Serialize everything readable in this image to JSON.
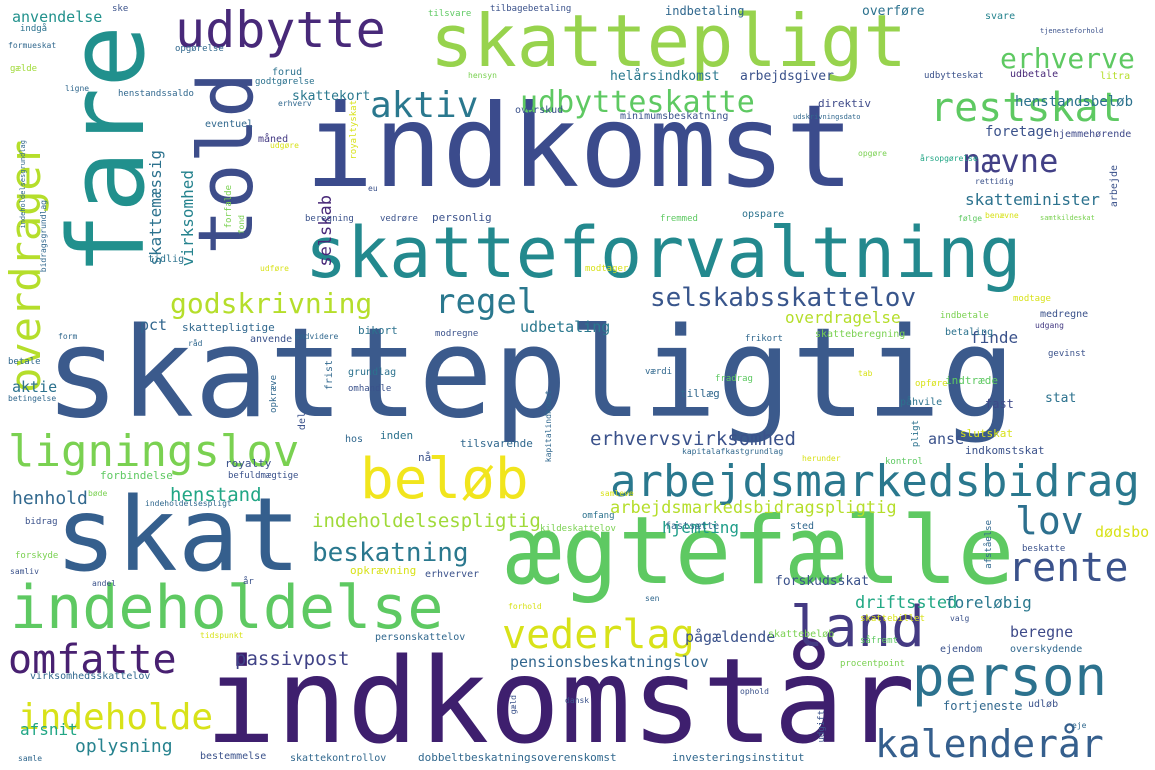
{
  "words": [
    {
      "text": "skattepligtig",
      "color": "#3b5a8c"
    },
    {
      "text": "indkomst",
      "color": "#3b4b8c"
    },
    {
      "text": "indkomstår",
      "color": "#3e1f6e"
    },
    {
      "text": "skattepligt",
      "color": "#97d34d"
    },
    {
      "text": "skatteforvaltning",
      "color": "#23898e"
    },
    {
      "text": "skat",
      "color": "#355f8d"
    },
    {
      "text": "ægtefælle",
      "color": "#5ec962"
    },
    {
      "text": "indeholdelse",
      "color": "#5ec962"
    },
    {
      "text": "fare",
      "color": "#21908d"
    },
    {
      "text": "told",
      "color": "#3d4d8a"
    },
    {
      "text": "udbytte",
      "color": "#482979"
    },
    {
      "text": "person",
      "color": "#2c728e"
    },
    {
      "text": "land",
      "color": "#443a83"
    },
    {
      "text": "arbejdsmarkedsbidrag",
      "color": "#2a788e"
    },
    {
      "text": "beløb",
      "color": "#f1e51d"
    },
    {
      "text": "ligningslov",
      "color": "#7ad151"
    },
    {
      "text": "omfatte",
      "color": "#482071"
    },
    {
      "text": "vederlag",
      "color": "#d8e219"
    },
    {
      "text": "kalenderår",
      "color": "#355f8d"
    },
    {
      "text": "rente",
      "color": "#3b528b"
    },
    {
      "text": "lov",
      "color": "#2d708e"
    },
    {
      "text": "restskat",
      "color": "#5ec962"
    },
    {
      "text": "aktiv",
      "color": "#2a788e"
    },
    {
      "text": "udbytteskatte",
      "color": "#5ec962"
    },
    {
      "text": "nævne",
      "color": "#424086"
    },
    {
      "text": "overdrager",
      "color": "#b5de2b"
    },
    {
      "text": "godskrivning",
      "color": "#b5de2b"
    },
    {
      "text": "regel",
      "color": "#2a788e"
    },
    {
      "text": "selskabsskattelov",
      "color": "#39568c"
    },
    {
      "text": "erhverve",
      "color": "#5ec962"
    },
    {
      "text": "indeholde",
      "color": "#d8e219"
    },
    {
      "text": "beskatning",
      "color": "#2a788e"
    },
    {
      "text": "henstand",
      "color": "#21a685"
    },
    {
      "text": "indeholdelsespligtig",
      "color": "#a0da39"
    },
    {
      "text": "erhvervsvirksomhed",
      "color": "#3b528b"
    },
    {
      "text": "arbejdsmarkedsbidragspligtig",
      "color": "#b5de2b"
    },
    {
      "text": "passivpost",
      "color": "#404387"
    },
    {
      "text": "pensionsbeskatningslov",
      "color": "#31668e"
    },
    {
      "text": "oplysning",
      "color": "#26828e"
    },
    {
      "text": "afsnit",
      "color": "#21a685"
    },
    {
      "text": "anvendelse",
      "color": "#21918c"
    },
    {
      "text": "henstandsbeløb",
      "color": "#2c728e"
    },
    {
      "text": "skatteminister",
      "color": "#2c728e"
    },
    {
      "text": "foretage",
      "color": "#3b528b"
    },
    {
      "text": "hjemmehørende",
      "color": "#3e4989"
    },
    {
      "text": "overdragelse",
      "color": "#b5de2b"
    },
    {
      "text": "udbetaling",
      "color": "#2a788e"
    },
    {
      "text": "finde",
      "color": "#3b528b"
    },
    {
      "text": "pct",
      "color": "#31668e"
    },
    {
      "text": "aktie",
      "color": "#2c728e"
    },
    {
      "text": "henhold",
      "color": "#31688e"
    },
    {
      "text": "hjemting",
      "color": "#1f9e89"
    },
    {
      "text": "dødsbo",
      "color": "#d8e219"
    },
    {
      "text": "driftssted",
      "color": "#22a884"
    },
    {
      "text": "pågældende",
      "color": "#3b528b"
    },
    {
      "text": "foreløbig",
      "color": "#2a788e"
    },
    {
      "text": "beregne",
      "color": "#3e4a89"
    },
    {
      "text": "forskudsskat",
      "color": "#3b528b"
    },
    {
      "text": "fortjeneste",
      "color": "#31688e"
    },
    {
      "text": "anse",
      "color": "#3b528b"
    },
    {
      "text": "fast",
      "color": "#3e4a89"
    },
    {
      "text": "stat",
      "color": "#2c728e"
    },
    {
      "text": "selskab",
      "color": "#482878"
    },
    {
      "text": "skattemæssig",
      "color": "#2c728e"
    },
    {
      "text": "virksomhed",
      "color": "#25838e"
    },
    {
      "text": "skattekort",
      "color": "#2a788e"
    },
    {
      "text": "helårsindkomst",
      "color": "#2a788e"
    },
    {
      "text": "arbejdsgiver",
      "color": "#3b528b"
    },
    {
      "text": "direktiv",
      "color": "#3e4a89"
    },
    {
      "text": "minimumsbeskatning",
      "color": "#3b528b"
    },
    {
      "text": "indbetaling",
      "color": "#31688e"
    },
    {
      "text": "overføre",
      "color": "#2c728e"
    },
    {
      "text": "svare",
      "color": "#25838e"
    },
    {
      "text": "tilsvare",
      "color": "#5ec962"
    },
    {
      "text": "tilbagebetaling",
      "color": "#3b528b"
    },
    {
      "text": "udbetale",
      "color": "#482878"
    },
    {
      "text": "udbytteskat",
      "color": "#3b528b"
    },
    {
      "text": "litra",
      "color": "#b5de2b"
    },
    {
      "text": "overskud",
      "color": "#3b528b"
    },
    {
      "text": "forud",
      "color": "#2c728e"
    },
    {
      "text": "godtgørelse",
      "color": "#2c728e"
    },
    {
      "text": "eventuel",
      "color": "#31688e"
    },
    {
      "text": "måned",
      "color": "#443a83"
    },
    {
      "text": "henstandssaldo",
      "color": "#31688e"
    },
    {
      "text": "ske",
      "color": "#3b528b"
    },
    {
      "text": "indgå",
      "color": "#2c728e"
    },
    {
      "text": "formueskat",
      "color": "#31688e"
    },
    {
      "text": "gælde",
      "color": "#a0da39"
    },
    {
      "text": "ligne",
      "color": "#31688e"
    },
    {
      "text": "opgørelse",
      "color": "#31688e"
    },
    {
      "text": "tidlig",
      "color": "#2c728e"
    },
    {
      "text": "beregning",
      "color": "#3b528b"
    },
    {
      "text": "vedrøre",
      "color": "#3b528b"
    },
    {
      "text": "personlig",
      "color": "#3b528b"
    },
    {
      "text": "fremmed",
      "color": "#5ec962"
    },
    {
      "text": "opspare",
      "color": "#2c728e"
    },
    {
      "text": "følge",
      "color": "#5ec962"
    },
    {
      "text": "benævne",
      "color": "#d8e219"
    },
    {
      "text": "samtkildeskat",
      "color": "#7ad151"
    },
    {
      "text": "rettidig",
      "color": "#3b528b"
    },
    {
      "text": "årsopgørelse",
      "color": "#21a685"
    },
    {
      "text": "opgøre",
      "color": "#7ad151"
    },
    {
      "text": "udskrivningsdato",
      "color": "#31688e"
    },
    {
      "text": "arbejde",
      "color": "#3b528b"
    },
    {
      "text": "modtage",
      "color": "#d8e219"
    },
    {
      "text": "medregne",
      "color": "#3b528b"
    },
    {
      "text": "udgang",
      "color": "#443a83"
    },
    {
      "text": "betaling",
      "color": "#2c728e"
    },
    {
      "text": "indbetale",
      "color": "#7ad151"
    },
    {
      "text": "skatteberegning",
      "color": "#7ad151"
    },
    {
      "text": "frikort",
      "color": "#31688e"
    },
    {
      "text": "gevinst",
      "color": "#3b528b"
    },
    {
      "text": "påhvile",
      "color": "#2c728e"
    },
    {
      "text": "indtræde",
      "color": "#5ec962"
    },
    {
      "text": "opføre",
      "color": "#d8e219"
    },
    {
      "text": "tillæg",
      "color": "#31688e"
    },
    {
      "text": "fradrag",
      "color": "#5ec962"
    },
    {
      "text": "værdi",
      "color": "#31688e"
    },
    {
      "text": "tab",
      "color": "#d8e219"
    },
    {
      "text": "modregne",
      "color": "#3b528b"
    },
    {
      "text": "bikort",
      "color": "#2c728e"
    },
    {
      "text": "skattepligtige",
      "color": "#31688e"
    },
    {
      "text": "anvende",
      "color": "#3b528b"
    },
    {
      "text": "endvidere",
      "color": "#31688e"
    },
    {
      "text": "form",
      "color": "#31688e"
    },
    {
      "text": "råd",
      "color": "#31688e"
    },
    {
      "text": "betale",
      "color": "#31688e"
    },
    {
      "text": "betingelse",
      "color": "#31688e"
    },
    {
      "text": "grundlag",
      "color": "#2c728e"
    },
    {
      "text": "omhandle",
      "color": "#3b528b"
    },
    {
      "text": "frist",
      "color": "#31688e"
    },
    {
      "text": "opkræve",
      "color": "#31688e"
    },
    {
      "text": "del",
      "color": "#3b528b"
    },
    {
      "text": "hos",
      "color": "#31688e"
    },
    {
      "text": "inden",
      "color": "#2c728e"
    },
    {
      "text": "nå",
      "color": "#3b528b"
    },
    {
      "text": "tilsvarende",
      "color": "#31688e"
    },
    {
      "text": "kapitalafkastgrundlag",
      "color": "#31688e"
    },
    {
      "text": "kapitalindkomst",
      "color": "#31688e"
    },
    {
      "text": "herunder",
      "color": "#d8e219"
    },
    {
      "text": "kontrol",
      "color": "#5ec962"
    },
    {
      "text": "slutskat",
      "color": "#d8e219"
    },
    {
      "text": "indkomstskat",
      "color": "#3b528b"
    },
    {
      "text": "pligt",
      "color": "#2c728e"
    },
    {
      "text": "forbindelse",
      "color": "#5ec962"
    },
    {
      "text": "royalty",
      "color": "#3b528b"
    },
    {
      "text": "befuldmægtige",
      "color": "#3b528b"
    },
    {
      "text": "bøde",
      "color": "#7ad151"
    },
    {
      "text": "bidrag",
      "color": "#3b528b"
    },
    {
      "text": "indeholdelsespligt",
      "color": "#31688e"
    },
    {
      "text": "samleve",
      "color": "#d8e219"
    },
    {
      "text": "omfang",
      "color": "#2c728e"
    },
    {
      "text": "kildeskattelov",
      "color": "#7ad151"
    },
    {
      "text": "fastsætte",
      "color": "#31688e"
    },
    {
      "text": "sted",
      "color": "#31688e"
    },
    {
      "text": "forskyde",
      "color": "#7ad151"
    },
    {
      "text": "samliv",
      "color": "#3b528b"
    },
    {
      "text": "andel",
      "color": "#3b528b"
    },
    {
      "text": "år",
      "color": "#3b528b"
    },
    {
      "text": "opkrævning",
      "color": "#d8e219"
    },
    {
      "text": "erhverver",
      "color": "#3b528b"
    },
    {
      "text": "afståelse",
      "color": "#31688e"
    },
    {
      "text": "beskatte",
      "color": "#3b528b"
    },
    {
      "text": "forhold",
      "color": "#d8e219"
    },
    {
      "text": "sen",
      "color": "#31688e"
    },
    {
      "text": "skattebillet",
      "color": "#d8e219"
    },
    {
      "text": "valg",
      "color": "#3b528b"
    },
    {
      "text": "skattebeløb",
      "color": "#7ad151"
    },
    {
      "text": "såfremt",
      "color": "#5ec962"
    },
    {
      "text": "ejendom",
      "color": "#3b528b"
    },
    {
      "text": "overskydende",
      "color": "#31688e"
    },
    {
      "text": "tidspunkt",
      "color": "#d8e219"
    },
    {
      "text": "personskattelov",
      "color": "#31688e"
    },
    {
      "text": "procentpoint",
      "color": "#7ad151"
    },
    {
      "text": "virksomhedsskattelov",
      "color": "#31688e"
    },
    {
      "text": "dansk",
      "color": "#3b528b"
    },
    {
      "text": "gæld",
      "color": "#3b528b"
    },
    {
      "text": "ophold",
      "color": "#3b528b"
    },
    {
      "text": "udgift",
      "color": "#3b528b"
    },
    {
      "text": "udløb",
      "color": "#3b528b"
    },
    {
      "text": "eje",
      "color": "#31688e"
    },
    {
      "text": "samle",
      "color": "#31688e"
    },
    {
      "text": "bestemmelse",
      "color": "#3b528b"
    },
    {
      "text": "skattekontrollov",
      "color": "#31688e"
    },
    {
      "text": "dobbeltbeskatningsoverenskomst",
      "color": "#31688e"
    },
    {
      "text": "investeringsinstitut",
      "color": "#31688e"
    },
    {
      "text": "indeholdelsesgrundlag",
      "color": "#31688e"
    },
    {
      "text": "bidragsgrundlag",
      "color": "#31688e"
    },
    {
      "text": "eu",
      "color": "#3b528b"
    },
    {
      "text": "royaltyskat",
      "color": "#d8e219"
    },
    {
      "text": "udgøre",
      "color": "#d8e219"
    },
    {
      "text": "forfalde",
      "color": "#7ad151"
    },
    {
      "text": "fond",
      "color": "#7ad151"
    },
    {
      "text": "erhverv",
      "color": "#31688e"
    },
    {
      "text": "hensyn",
      "color": "#7ad151"
    },
    {
      "text": "tjenesteforhold",
      "color": "#3b528b"
    },
    {
      "text": "udføre",
      "color": "#d8e219"
    },
    {
      "text": "modtager",
      "color": "#d8e219"
    }
  ]
}
